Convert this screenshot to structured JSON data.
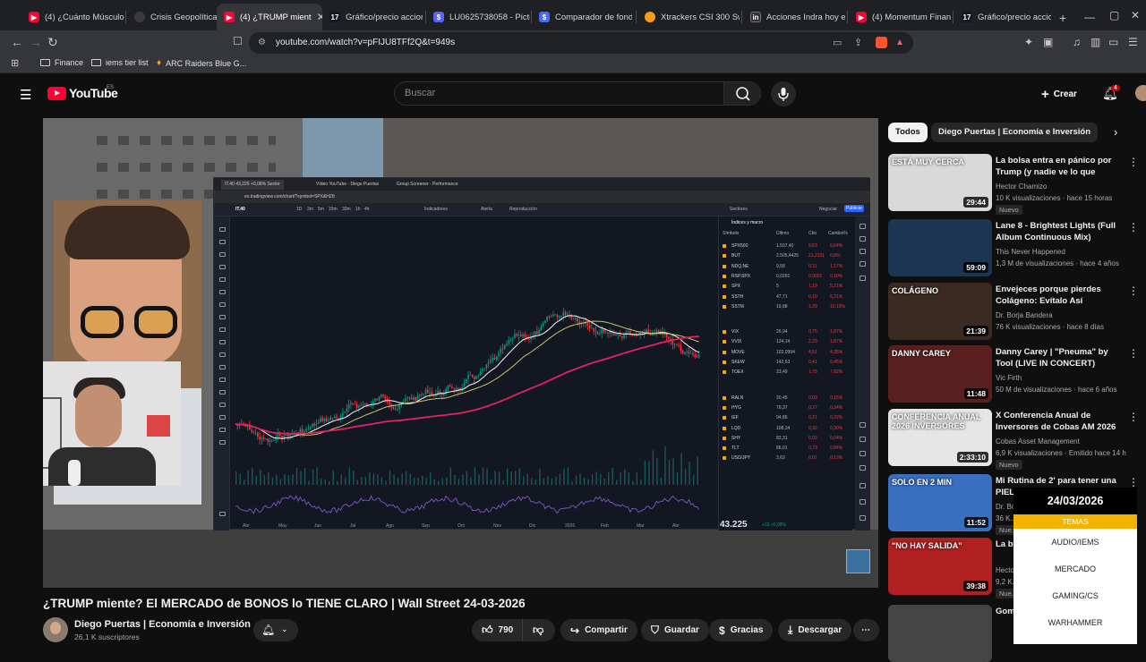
{
  "tabs": [
    {
      "label": "(4) ¿Cuánto Músculo E",
      "icon": "youtube-icon"
    },
    {
      "label": "Crisis Geopolítica 2026",
      "icon": "globe-icon"
    },
    {
      "label": "(4) ¿TRUMP mient",
      "icon": "youtube-icon",
      "active": true
    },
    {
      "label": "Gráfico/precio accione",
      "icon": "tradingview-icon"
    },
    {
      "label": "LU0625738058 - Pictet",
      "icon": "pictet-icon"
    },
    {
      "label": "Comparador de fondo",
      "icon": "comparator-icon"
    },
    {
      "label": "Xtrackers CSI 300 Swa",
      "icon": "xtrackers-icon"
    },
    {
      "label": "Acciones Indra hoy en",
      "icon": "investing-icon"
    },
    {
      "label": "(4) Momentum Financ",
      "icon": "youtube-icon"
    },
    {
      "label": "Gráfico/precio accione",
      "icon": "tradingview-icon"
    }
  ],
  "address": {
    "url": "youtube.com/watch?v=pFIJU8TFf2Q&t=949s"
  },
  "bookmarks": [
    {
      "label": "Finance"
    },
    {
      "label": "iems tier list"
    },
    {
      "label": "ARC Raiders Blue G..."
    }
  ],
  "header": {
    "logo": "YouTube",
    "logo_country": "ES",
    "search_placeholder": "Buscar",
    "create_label": "Crear",
    "notifications_count": "4"
  },
  "embedded_chart": {
    "url": "es.tradingview.com/chart/?symbol=SPX&HZ8",
    "symbol": "IT.40",
    "price": "43.225",
    "change": "+33 +0,08%",
    "tabs": [
      "IT.40 43,225 +0,08% Sector",
      "Vídeo YouTube - Diego Puertas",
      "Group Screener - Performance"
    ],
    "toolbar": [
      "1D",
      "3m",
      "5m",
      "15m",
      "30m",
      "1h",
      "4h",
      "Indicadores",
      "Alerta",
      "Reproducción",
      "Sectores",
      "Negociar",
      "Publicar"
    ],
    "watchlist_title": "Índices y macro",
    "watchlist_headers": [
      "Símbolo",
      "Último",
      "Cbo",
      "Cambio%"
    ],
    "watchlist": [
      {
        "sym": "SPX500",
        "last": "1.507,40",
        "chg": "9,63",
        "pct": "0,64%"
      },
      {
        "sym": "BUT",
        "last": "2.505,4425",
        "chg": "21,2151",
        "pct": "0,8%"
      },
      {
        "sym": "NDQ.NE",
        "last": "9,58",
        "chg": "0,11",
        "pct": "1,17%"
      },
      {
        "sym": "RSP.SPX",
        "last": "0,0291",
        "chg": "0,0001",
        "pct": "0,10%"
      },
      {
        "sym": "SPX",
        "last": "5",
        "chg": "1,19",
        "pct": "5,21%"
      },
      {
        "sym": "SSTH",
        "last": "47,71",
        "chg": "0,10",
        "pct": "5,21%"
      },
      {
        "sym": "SSTM",
        "last": "19,88",
        "chg": "1,29",
        "pct": "10,10%"
      },
      {
        "sym": "VIX",
        "last": "26,94",
        "chg": "0,75",
        "pct": "1,87%"
      },
      {
        "sym": "VVIX",
        "last": "124,14",
        "chg": "2,23",
        "pct": "1,87%"
      },
      {
        "sym": "MOVE",
        "last": "102,0994",
        "chg": "4,51",
        "pct": "4,35%"
      },
      {
        "sym": "SKEW",
        "last": "142,63",
        "chg": "0,41",
        "pct": "0,45%"
      },
      {
        "sym": "TOEX",
        "last": "23,49",
        "chg": "1,75",
        "pct": "7,82%"
      },
      {
        "sym": "RALN",
        "last": "20,45",
        "chg": "0,03",
        "pct": "0,15%"
      },
      {
        "sym": "HYG",
        "last": "79,37",
        "chg": "0,27",
        "pct": "0,34%"
      },
      {
        "sym": "IEF",
        "last": "94,86",
        "chg": "0,21",
        "pct": "0,22%"
      },
      {
        "sym": "LQD",
        "last": "108,34",
        "chg": "0,32",
        "pct": "0,30%"
      },
      {
        "sym": "SHY",
        "last": "82,31",
        "chg": "0,03",
        "pct": "0,04%"
      },
      {
        "sym": "TLT",
        "last": "86,01",
        "chg": "0,73",
        "pct": "0,84%"
      },
      {
        "sym": "USD/JPY",
        "last": "3,63",
        "chg": "0,01",
        "pct": "0,13%"
      }
    ],
    "months": [
      "Abr",
      "May",
      "Jun",
      "Jul",
      "Ago",
      "Sep",
      "Oct",
      "Nov",
      "Dic",
      "2026",
      "Feb",
      "Mar",
      "Abr"
    ]
  },
  "video": {
    "title": "¿TRUMP miente? El MERCADO de BONOS lo TIENE CLARO | Wall Street 24-03-2026",
    "channel": "Diego Puertas | Economía e Inversión",
    "subscribers": "26,1 K suscriptores",
    "likes": "790",
    "actions": {
      "share": "Compartir",
      "save": "Guardar",
      "thanks": "Gracias",
      "download": "Descargar"
    }
  },
  "chips": [
    {
      "label": "Todos",
      "active": true
    },
    {
      "label": "Diego Puertas | Economía e Inversión",
      "active": false
    }
  ],
  "recommendations": [
    {
      "title": "La bolsa entra en pánico por Trump (y nadie ve lo que viene...",
      "channel": "Hector Chamizo",
      "meta": "10 K visualizaciones · hace 15 horas",
      "badge": "Nuevo",
      "duration": "29:44",
      "thumb_text": "ESTÁ MUY CERCA",
      "thumb_color": "#d9d9d9"
    },
    {
      "title": "Lane 8 - Brightest Lights (Full Album Continuous Mix)",
      "channel": "This Never Happened",
      "meta": "1,3 M de visualizaciones · hace 4 años",
      "badge": "",
      "duration": "59:09",
      "thumb_text": "",
      "thumb_color": "#1c3550"
    },
    {
      "title": "Envejeces porque pierdes Colágeno: Evítalo Así",
      "channel": "Dr. Borja Bandera",
      "meta": "76 K visualizaciones · hace 8 días",
      "badge": "",
      "duration": "21:39",
      "thumb_text": "COLÁGENO",
      "thumb_color": "#3a2a22"
    },
    {
      "title": "Danny Carey | \"Pneuma\" by Tool (LIVE IN CONCERT)",
      "channel": "Vic Firth",
      "meta": "50 M de visualizaciones · hace 6 años",
      "badge": "",
      "duration": "11:48",
      "thumb_text": "DANNY CAREY",
      "thumb_color": "#5a2020"
    },
    {
      "title": "X Conferencia Anual de Inversores de Cobas AM 2026",
      "channel": "Cobas Asset Management",
      "meta": "6,9 K visualizaciones · Emitido hace 14 h",
      "badge": "Nuevo",
      "duration": "2:33:10",
      "thumb_text": "CONFERENCIA ANUAL 2026 INVERSORES",
      "thumb_color": "#e6e6e6"
    },
    {
      "title": "Mi Rutina de 2' para tener una PIEL...",
      "channel": "Dr. Bo...",
      "meta": "36 K...",
      "badge": "Nue...",
      "duration": "11:52",
      "thumb_text": "SOLO EN 2 MIN",
      "thumb_color": "#3a6fc0"
    },
    {
      "title": "La bo... peligr...",
      "channel": "Hecto...",
      "meta": "9,2 K...",
      "badge": "Nue...",
      "duration": "39:38",
      "thumb_text": "\"NO HAY SALIDA\"",
      "thumb_color": "#b02020"
    },
    {
      "title": "Gom...",
      "channel": "",
      "meta": "",
      "badge": "",
      "duration": "",
      "thumb_text": "",
      "thumb_color": "#444"
    }
  ],
  "overlay": {
    "date": "24/03/2026",
    "heading": "TEMAS",
    "items": [
      "AUDIO/IEMS",
      "MERCADO",
      "GAMING/CS",
      "WARHAMMER"
    ]
  },
  "colors": {
    "background": "#0f0f0f",
    "youtube_red": "#ff0033",
    "price_ma": "#e0245e",
    "overlay_accent": "#f2b400"
  }
}
